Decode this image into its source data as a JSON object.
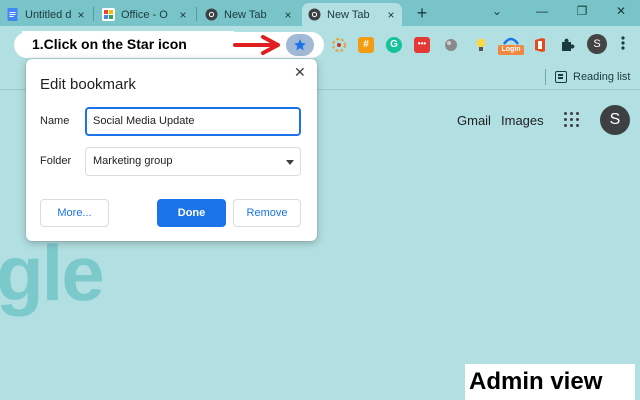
{
  "tabs": [
    {
      "title": "Untitled d",
      "icon": "docs-icon",
      "active": false
    },
    {
      "title": "Office - O",
      "icon": "office-icon",
      "active": false
    },
    {
      "title": "New Tab",
      "icon": "chrome-icon",
      "active": false
    },
    {
      "title": "New Tab",
      "icon": "chrome-icon",
      "active": true
    }
  ],
  "tab_close_glyph": "×",
  "new_tab_glyph": "+",
  "window_controls": {
    "chevron": "⌄",
    "minimize": "—",
    "maximize": "❐",
    "close": "✕"
  },
  "toolbar": {
    "instruction": "1.Click on the Star icon",
    "login_badge": "Login",
    "avatar_letter": "S",
    "extensions": [
      "colorful-circle-icon",
      "hash-icon",
      "grammarly-icon",
      "menu-dots-ext-icon",
      "orb-icon",
      "lightbulb-icon",
      "login-ext-icon",
      "office-ext-icon",
      "puzzle-icon"
    ]
  },
  "bookmarks_bar": {
    "reading_list": "Reading list"
  },
  "page": {
    "gmail": "Gmail",
    "images": "Images",
    "avatar_letter": "S",
    "logo_fragment": "gle",
    "caption": "Admin view"
  },
  "dialog": {
    "title": "Edit bookmark",
    "close_glyph": "✕",
    "name_label": "Name",
    "name_value": "Social Media Update",
    "folder_label": "Folder",
    "folder_value": "Marketing group",
    "more_button": "More...",
    "done_button": "Done",
    "remove_button": "Remove"
  },
  "colors": {
    "frame": "#79c4c8",
    "toolbar": "#b2dfe1",
    "accent": "#1a73e8",
    "arrow": "#e02020",
    "star_bg": "#9fb9d6",
    "logo": "#7cc9cc"
  }
}
